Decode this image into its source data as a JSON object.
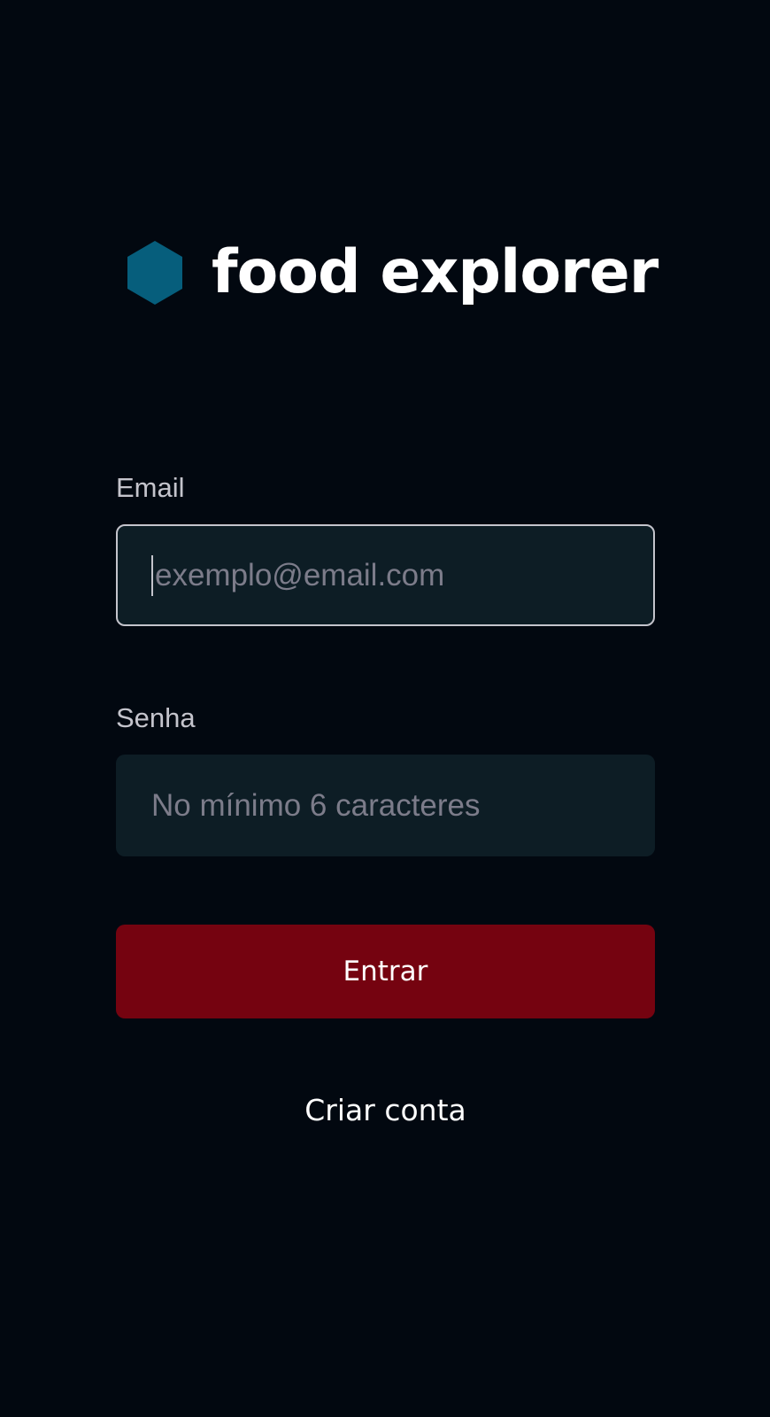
{
  "brand": {
    "name": "food explorer",
    "icon": "hexagon-icon",
    "icon_color": "#065e7c"
  },
  "login_form": {
    "email": {
      "label": "Email",
      "placeholder": "exemplo@email.com",
      "value": ""
    },
    "password": {
      "label": "Senha",
      "placeholder": "No mínimo 6 caracteres",
      "value": ""
    },
    "submit_label": "Entrar",
    "create_account_label": "Criar conta"
  },
  "colors": {
    "background": "#020810",
    "input_background": "#0d1d25",
    "button": "#750310",
    "label": "#c4c4cc",
    "placeholder": "#7c7c8a"
  }
}
